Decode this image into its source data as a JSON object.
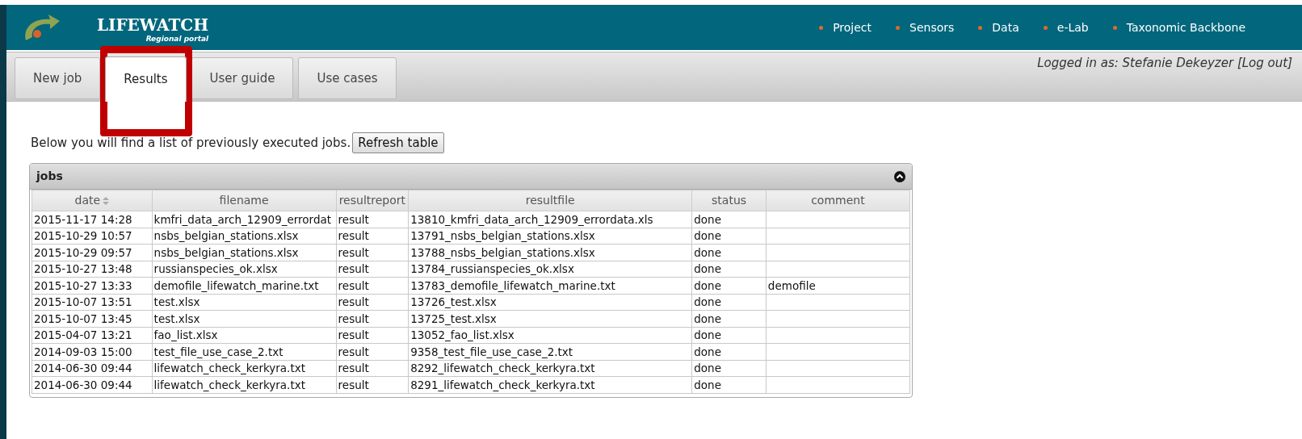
{
  "header": {
    "logo_title": "LIFEWATCH",
    "logo_subtitle": "Regional portal",
    "nav": [
      "Project",
      "Sensors",
      "Data",
      "e-Lab",
      "Taxonomic Backbone"
    ]
  },
  "tabs": [
    {
      "label": "New job",
      "selected": false
    },
    {
      "label": "Results",
      "selected": true
    },
    {
      "label": "User guide",
      "selected": false
    },
    {
      "label": "Use cases",
      "selected": false
    }
  ],
  "login": "Logged in as: Stefanie Dekeyzer [Log out]",
  "intro": "Below you will find a list of previously executed jobs.",
  "refresh_button": "Refresh table",
  "table": {
    "title": "jobs",
    "columns": [
      {
        "label": "date",
        "sortable": true
      },
      {
        "label": "filename",
        "sortable": false
      },
      {
        "label": "resultreport",
        "sortable": false
      },
      {
        "label": "resultfile",
        "sortable": false
      },
      {
        "label": "status",
        "sortable": false
      },
      {
        "label": "comment",
        "sortable": false
      }
    ],
    "rows": [
      [
        "2015-11-17 14:28",
        "kmfri_data_arch_12909_errordat",
        "result",
        "13810_kmfri_data_arch_12909_errordata.xls",
        "done",
        ""
      ],
      [
        "2015-10-29 10:57",
        "nsbs_belgian_stations.xlsx",
        "result",
        "13791_nsbs_belgian_stations.xlsx",
        "done",
        ""
      ],
      [
        "2015-10-29 09:57",
        "nsbs_belgian_stations.xlsx",
        "result",
        "13788_nsbs_belgian_stations.xlsx",
        "done",
        ""
      ],
      [
        "2015-10-27 13:48",
        "russianspecies_ok.xlsx",
        "result",
        "13784_russianspecies_ok.xlsx",
        "done",
        ""
      ],
      [
        "2015-10-27 13:33",
        "demofile_lifewatch_marine.txt",
        "result",
        "13783_demofile_lifewatch_marine.txt",
        "done",
        "demofile"
      ],
      [
        "2015-10-07 13:51",
        "test.xlsx",
        "result",
        "13726_test.xlsx",
        "done",
        ""
      ],
      [
        "2015-10-07 13:45",
        "test.xlsx",
        "result",
        "13725_test.xlsx",
        "done",
        ""
      ],
      [
        "2015-04-07 13:21",
        "fao_list.xlsx",
        "result",
        "13052_fao_list.xlsx",
        "done",
        ""
      ],
      [
        "2014-09-03 15:00",
        "test_file_use_case_2.txt",
        "result",
        "9358_test_file_use_case_2.txt",
        "done",
        ""
      ],
      [
        "2014-06-30 09:44",
        "lifewatch_check_kerkyra.txt",
        "result",
        "8292_lifewatch_check_kerkyra.txt",
        "done",
        ""
      ],
      [
        "2014-06-30 09:44",
        "lifewatch_check_kerkyra.txt",
        "result",
        "8291_lifewatch_check_kerkyra.txt",
        "done",
        ""
      ]
    ]
  }
}
